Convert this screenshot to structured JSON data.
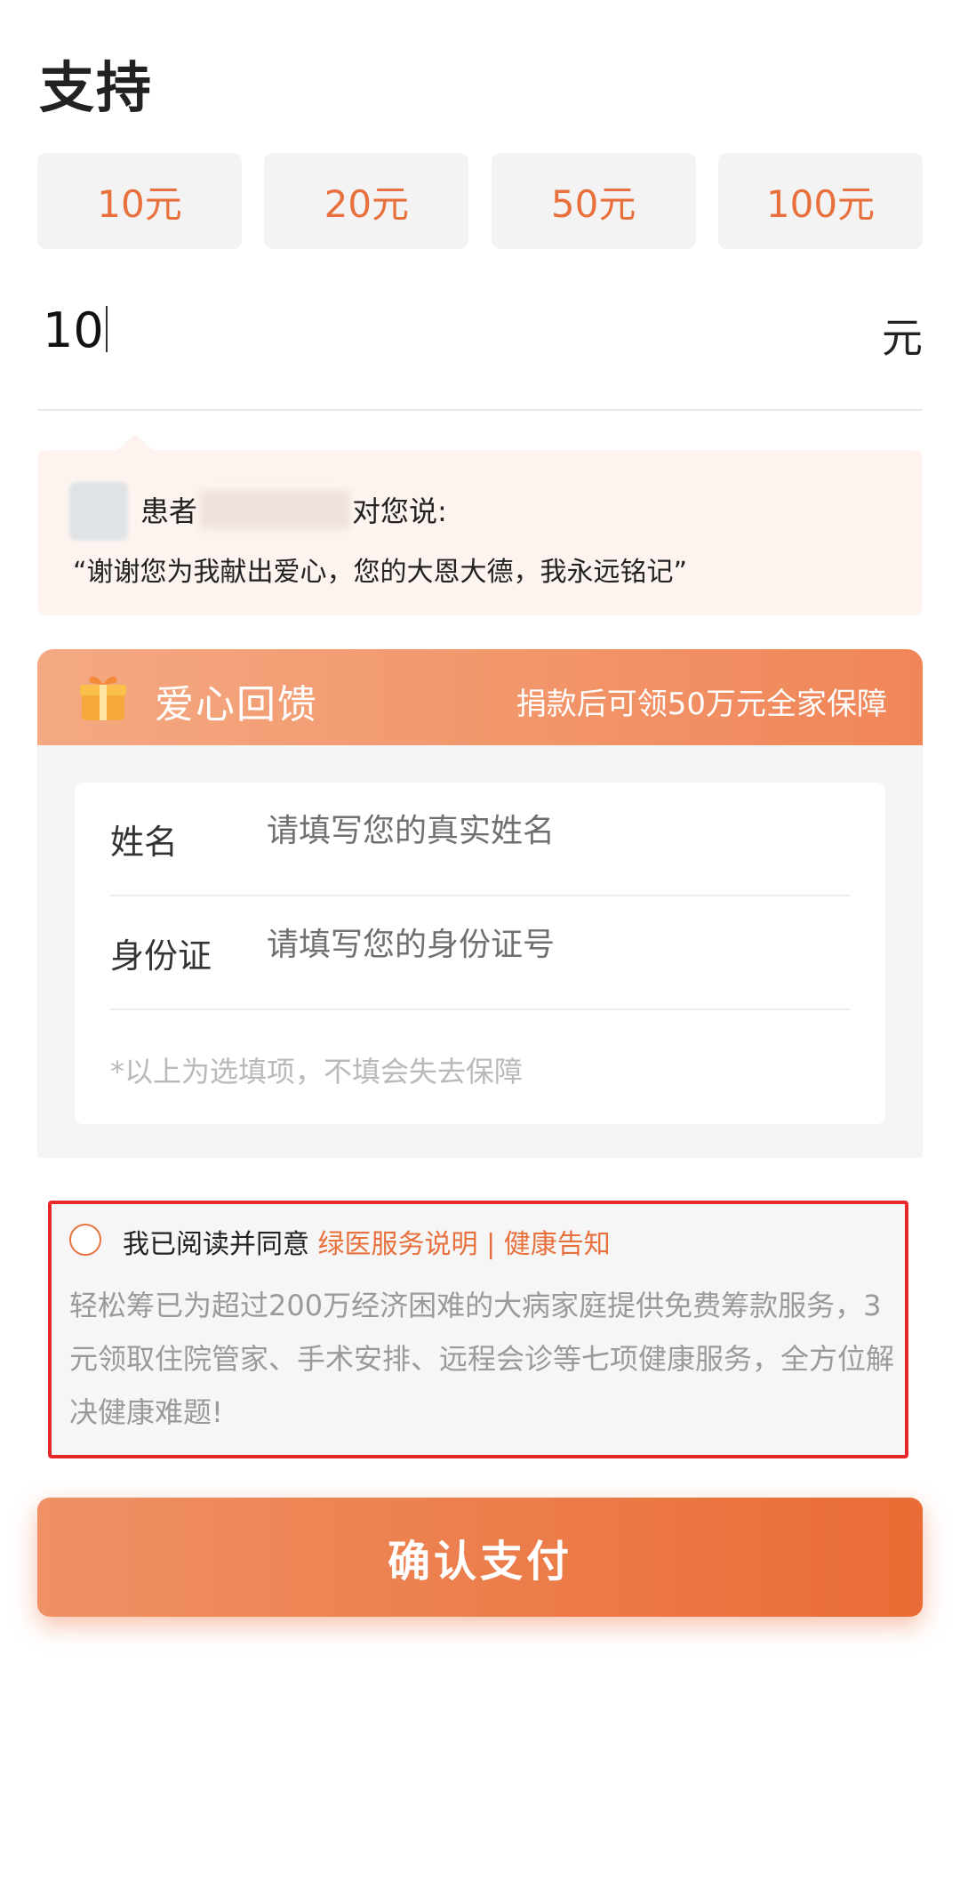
{
  "page_title": "支持",
  "amount_options": [
    "10元",
    "20元",
    "50元",
    "100元"
  ],
  "amount_input": {
    "value": "10",
    "unit": "元"
  },
  "quote": {
    "prefix": "患者",
    "suffix": "对您说:",
    "text": "“谢谢您为我献出爱心，您的大恩大德，我永远铭记”"
  },
  "gift": {
    "title": "爱心回馈",
    "subtitle": "捐款后可领50万元全家保障",
    "icon": "gift-icon",
    "fields": [
      {
        "label": "姓名",
        "placeholder": "请填写您的真实姓名"
      },
      {
        "label": "身份证",
        "placeholder": "请填写您的身份证号"
      }
    ],
    "note": "*以上为选填项，不填会失去保障"
  },
  "agreement": {
    "prefix": "我已阅读并同意",
    "link_text": "绿医服务说明 | 健康告知",
    "description": "轻松筹已为超过200万经济困难的大病家庭提供免费筹款服务，3元领取住院管家、手术安排、远程会诊等七项健康服务，全方位解决健康难题!"
  },
  "pay_button": "确认支付",
  "colors": {
    "accent": "#e8703c",
    "highlight_border": "#e8272a",
    "quote_bg": "#fdf4ef"
  }
}
